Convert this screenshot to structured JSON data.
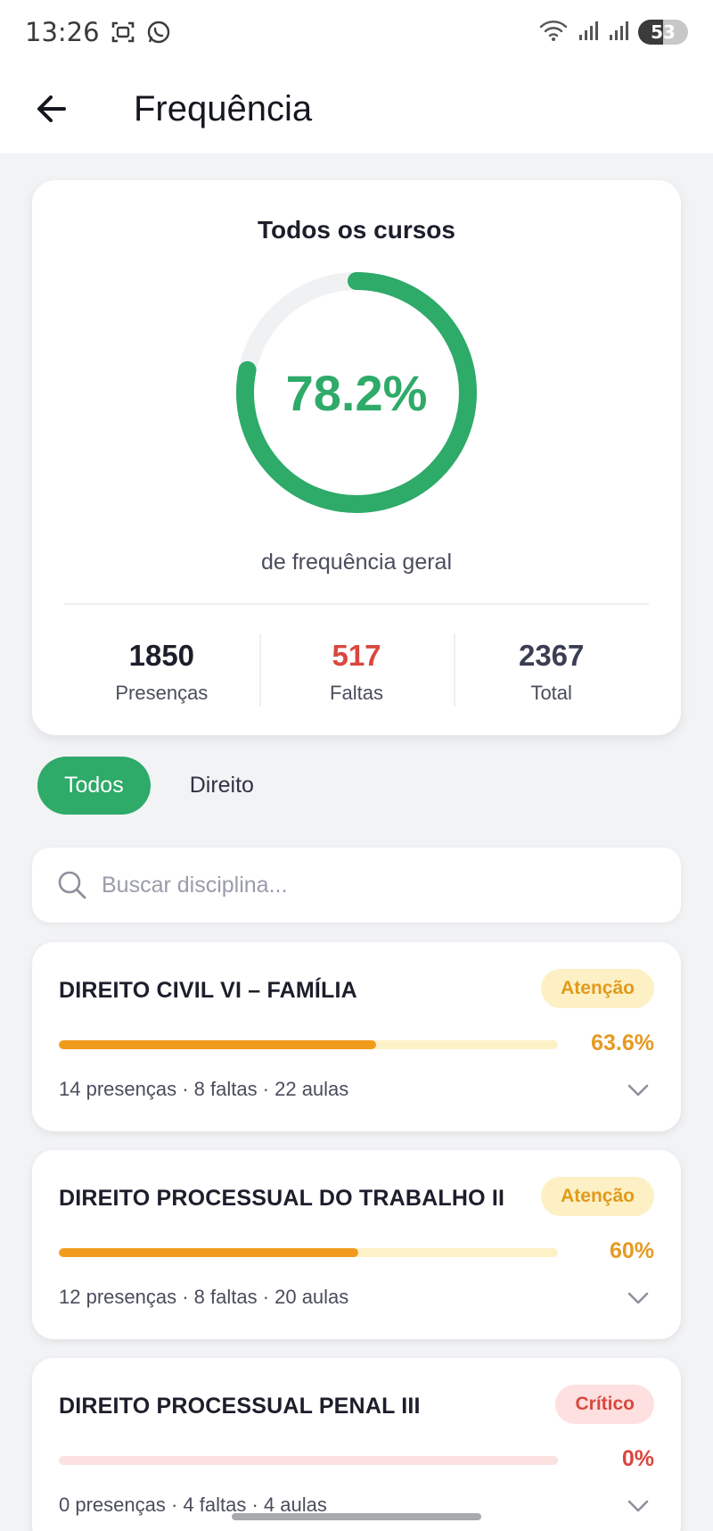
{
  "status_bar": {
    "time": "13:26",
    "battery": "53",
    "icons": [
      "screenshot-icon",
      "whatsapp-icon",
      "wifi-icon",
      "signal-icon",
      "signal-icon",
      "battery-icon"
    ]
  },
  "header": {
    "title": "Frequência",
    "back_icon": "arrow-left-icon"
  },
  "summary": {
    "title": "Todos os cursos",
    "percent_label": "78.2%",
    "percent_value": 78.2,
    "caption": "de frequência geral",
    "stats": [
      {
        "value": "1850",
        "label": "Presenças",
        "color": "#1c1e2b"
      },
      {
        "value": "517",
        "label": "Faltas",
        "color": "#d9473e"
      },
      {
        "value": "2367",
        "label": "Total",
        "color": "#3b3e52"
      }
    ]
  },
  "filters": {
    "items": [
      "Todos",
      "Direito"
    ],
    "active": "Todos"
  },
  "search": {
    "placeholder": "Buscar disciplina...",
    "value": ""
  },
  "courses": [
    {
      "name": "DIREITO CIVIL VI – FAMÍLIA",
      "badge": "Atenção",
      "status": "warn",
      "percent_label": "63.6%",
      "percent_value": 63.6,
      "meta": "14 presenças · 8 faltas · 22 aulas"
    },
    {
      "name": "DIREITO PROCESSUAL DO TRABALHO II",
      "badge": "Atenção",
      "status": "warn",
      "percent_label": "60%",
      "percent_value": 60,
      "meta": "12 presenças · 8 faltas · 20 aulas"
    },
    {
      "name": "DIREITO PROCESSUAL PENAL III",
      "badge": "Crítico",
      "status": "crit",
      "percent_label": "0%",
      "percent_value": 0,
      "meta": "0 presenças · 4 faltas · 4 aulas"
    }
  ],
  "colors": {
    "accent": "#2eaa69",
    "warning": "#f19b1d",
    "critical": "#d9473e"
  }
}
